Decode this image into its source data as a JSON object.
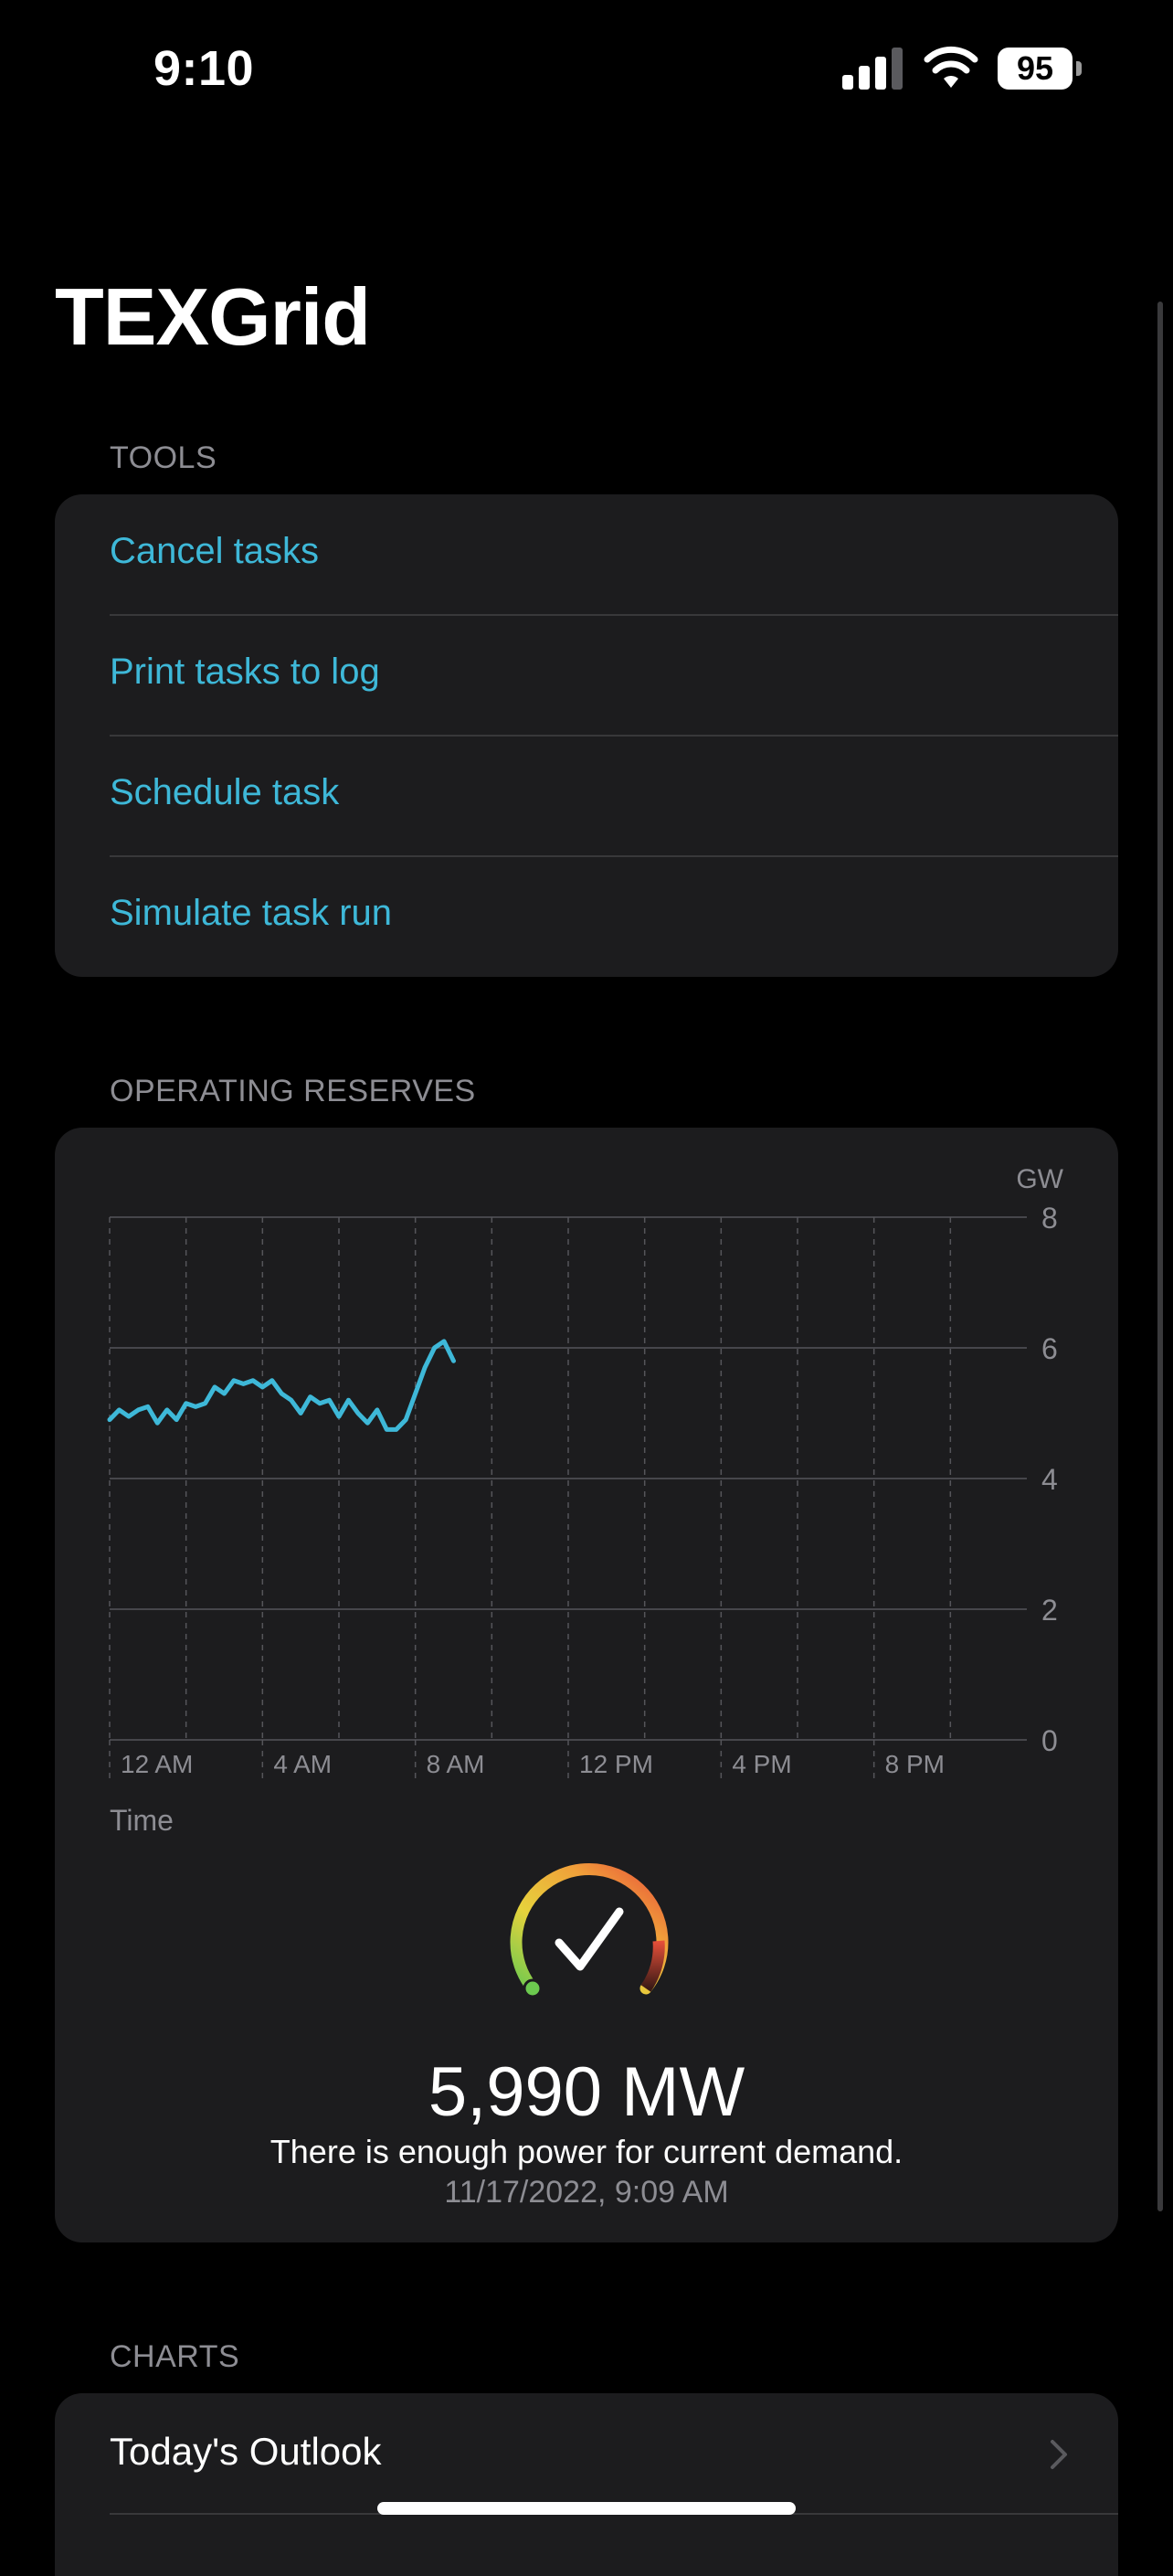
{
  "status_bar": {
    "time": "9:10",
    "battery": "95"
  },
  "app": {
    "title": "TEXGrid"
  },
  "tools": {
    "header": "TOOLS",
    "items": [
      {
        "label": "Cancel tasks"
      },
      {
        "label": "Print tasks to log"
      },
      {
        "label": "Schedule task"
      },
      {
        "label": "Simulate task run"
      }
    ]
  },
  "reserves": {
    "header": "OPERATING RESERVES",
    "value": "5,990 MW",
    "message": "There is enough power for current demand.",
    "timestamp": "11/17/2022, 9:09 AM",
    "status_icon": "checkmark-gauge-icon"
  },
  "chart_data": {
    "type": "line",
    "unit_label": "GW",
    "xlabel": "Time",
    "ylim": [
      0,
      8
    ],
    "xlim": [
      0,
      24
    ],
    "y_ticks": [
      "0",
      "2",
      "4",
      "6",
      "8"
    ],
    "x_ticks": [
      {
        "label": "12 AM",
        "hour": 0
      },
      {
        "label": "4 AM",
        "hour": 4
      },
      {
        "label": "8 AM",
        "hour": 8
      },
      {
        "label": "12 PM",
        "hour": 12
      },
      {
        "label": "4 PM",
        "hour": 16
      },
      {
        "label": "8 PM",
        "hour": 20
      }
    ],
    "line_color": "#3eb8d8",
    "series": [
      {
        "x": [
          0,
          0.25,
          0.5,
          0.75,
          1.0,
          1.25,
          1.5,
          1.75,
          2.0,
          2.25,
          2.5,
          2.75,
          3.0,
          3.25,
          3.5,
          3.75,
          4.0,
          4.25,
          4.5,
          4.75,
          5.0,
          5.25,
          5.5,
          5.75,
          6.0,
          6.25,
          6.5,
          6.75,
          7.0,
          7.25,
          7.5,
          7.75,
          8.0,
          8.25,
          8.5,
          8.75,
          9.0
        ],
        "y": [
          4.9,
          5.05,
          4.95,
          5.05,
          5.1,
          4.85,
          5.05,
          4.9,
          5.15,
          5.1,
          5.15,
          5.4,
          5.3,
          5.5,
          5.45,
          5.5,
          5.4,
          5.5,
          5.3,
          5.2,
          5.0,
          5.25,
          5.15,
          5.2,
          4.95,
          5.2,
          5.0,
          4.85,
          5.05,
          4.75,
          4.75,
          4.9,
          5.3,
          5.7,
          6.0,
          6.1,
          5.8
        ]
      }
    ]
  },
  "charts_section": {
    "header": "CHARTS",
    "items": [
      {
        "label": "Today's Outlook"
      }
    ]
  }
}
